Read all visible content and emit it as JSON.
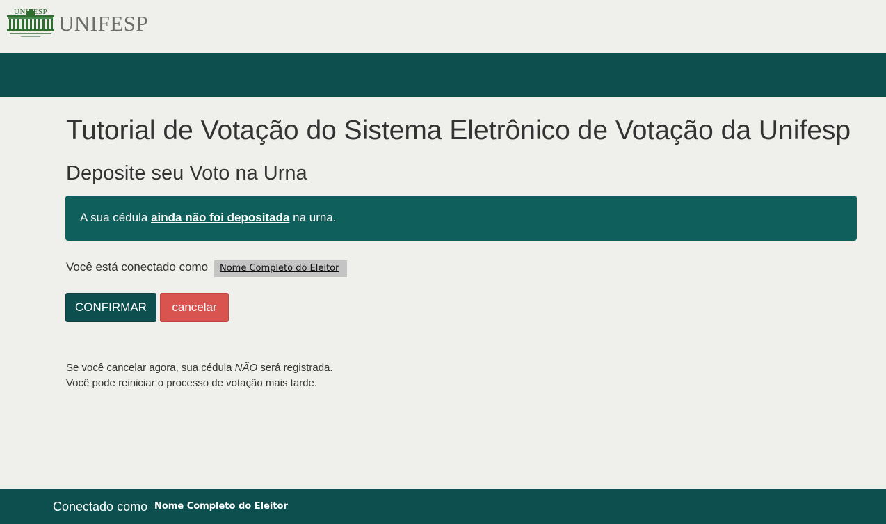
{
  "logo": {
    "small_text": "UNIFESP",
    "word_text": "UNIFESP"
  },
  "main": {
    "page_title": "Tutorial de Votação do Sistema Eletrônico de Votação da Unifesp",
    "section_title": "Deposite seu Voto na Urna",
    "alert": {
      "prefix": "A sua cédula ",
      "emphasis": "ainda não foi depositada",
      "suffix": " na urna."
    },
    "connected_label": "Você está conectado como",
    "voter_name": "Nome Completo do Eleitor",
    "buttons": {
      "confirm_label": "CONFIRMAR",
      "cancel_label": "cancelar"
    },
    "note": {
      "line1_prefix": "Se você cancelar agora, sua cédula ",
      "line1_emphasis": "NÃO",
      "line1_suffix": " será registrada.",
      "line2": "Você pode reiniciar o processo de votação mais tarde."
    }
  },
  "footer": {
    "connected_label": "Conectado como",
    "voter_name": "Nome Completo do Eleitor"
  },
  "colors": {
    "primary": "#0d4f4f",
    "alert_background": "#0f5f5c",
    "danger": "#d9534f",
    "page_background": "#eff0ec",
    "logo_green": "#2f6e2f"
  }
}
